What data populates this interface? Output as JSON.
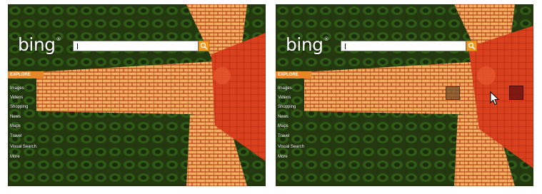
{
  "panels": [
    {
      "logo": "bing",
      "explore_label": "EXPLORE",
      "nav_items": [
        "Images",
        "Videos",
        "Shopping",
        "News",
        "Maps",
        "Travel",
        "Visual Search",
        "More"
      ]
    },
    {
      "logo": "bing",
      "explore_label": "EXPLORE",
      "nav_items": [
        "Images",
        "Videos",
        "Shopping",
        "News",
        "Maps",
        "Travel",
        "Visual Search",
        "More"
      ]
    }
  ],
  "colors": {
    "accent_orange": "#f39a1f",
    "explore_bar": "#e8862a",
    "hover_square_brown": "#785028",
    "hover_square_red": "#6e140f"
  },
  "icons": {
    "search": "search-icon",
    "cursor": "mouse-cursor-icon"
  }
}
